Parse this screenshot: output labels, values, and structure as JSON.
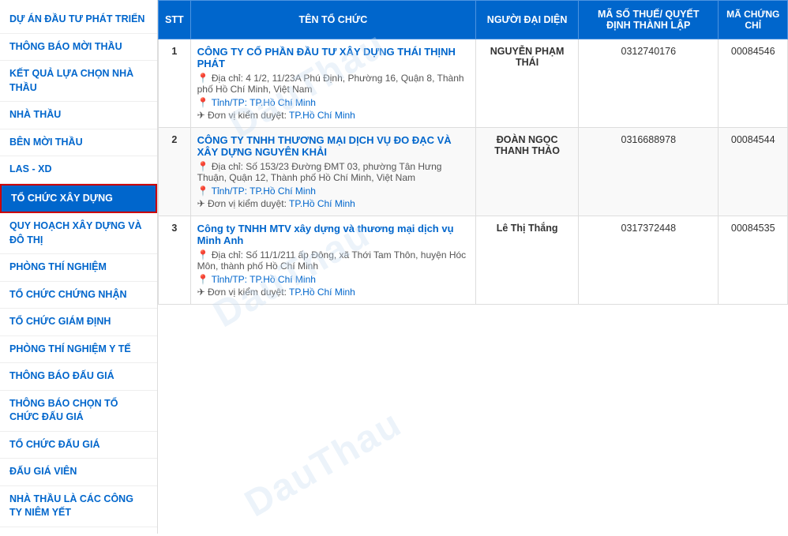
{
  "sidebar": {
    "items": [
      {
        "id": "duan",
        "label": "DỰ ÁN ĐẦU TƯ PHÁT TRIỂN",
        "active": false
      },
      {
        "id": "thongbaomoi",
        "label": "THÔNG BÁO MỜI THẦU",
        "active": false
      },
      {
        "id": "ketqua",
        "label": "KẾT QUẢ LỰA CHỌN NHÀ THẦU",
        "active": false
      },
      {
        "id": "nhathau",
        "label": "NHÀ THẦU",
        "active": false
      },
      {
        "id": "benmoithau",
        "label": "BÊN MỜI THẦU",
        "active": false
      },
      {
        "id": "lasxd",
        "label": "LAS - XD",
        "active": false
      },
      {
        "id": "tochucxaydung",
        "label": "TỔ CHỨC XÂY DỰNG",
        "active": true
      },
      {
        "id": "quyhoach",
        "label": "QUY HOẠCH XÂY DỰNG VÀ ĐÔ THỊ",
        "active": false
      },
      {
        "id": "phongthi",
        "label": "PHÒNG THÍ NGHIỆM",
        "active": false
      },
      {
        "id": "tochuchangnhan",
        "label": "TỔ CHỨC CHỨNG NHẬN",
        "active": false
      },
      {
        "id": "tochuchangiamdinh",
        "label": "TỔ CHỨC GIÁM ĐỊNH",
        "active": false
      },
      {
        "id": "phongthinghiemyte",
        "label": "PHÒNG THÍ NGHIỆM Y TẾ",
        "active": false
      },
      {
        "id": "thongbaodaugia",
        "label": "THÔNG BÁO ĐẤU GIÁ",
        "active": false
      },
      {
        "id": "thongbaochon",
        "label": "THÔNG BÁO CHỌN TỔ CHỨC ĐẤU GIÁ",
        "active": false
      },
      {
        "id": "tochucĐaugia",
        "label": "TỔ CHỨC ĐẤU GIÁ",
        "active": false
      },
      {
        "id": "daugiaviên",
        "label": "ĐẤU GIÁ VIÊN",
        "active": false
      },
      {
        "id": "nhathaulacac",
        "label": "NHÀ THẦU LÀ CÁC CÔNG TY NIÊM YẾT",
        "active": false
      }
    ]
  },
  "table": {
    "headers": {
      "stt": "STT",
      "tenToChuc": "TÊN TỔ CHỨC",
      "nguoiDaiDien": "NGƯỜI ĐẠI DIỆN",
      "maSoThue": "MÃ SỐ THUẾ/ QUYẾT ĐỊNH THÀNH LẬP",
      "maChungChi": "MÃ CHỨNG CHỈ"
    },
    "rows": [
      {
        "stt": "1",
        "orgName": "CÔNG TY CỔ PHẦN ĐẦU TƯ XÂY DỰNG THÁI THỊNH PHÁT",
        "address": "Địa chỉ: 4 1/2, 11/23A Phú Định, Phường 16, Quận 8, Thành phố Hồ Chí Minh, Việt Nam",
        "city": "Tỉnh/TP: TP.Hồ Chí Minh",
        "approveUnit": "Đơn vị kiểm duyệt: TP.Hồ Chí Minh",
        "rep": "NGUYỄN PHẠM THÁI",
        "taxCode": "0312740176",
        "certCode": "00084546"
      },
      {
        "stt": "2",
        "orgName": "CÔNG TY TNHH THƯƠNG MẠI DỊCH VỤ ĐO ĐẠC VÀ XÂY DỰNG NGUYÊN KHẢI",
        "address": "Địa chỉ: Số 153/23 Đường ĐMT 03, phường Tân Hưng Thuận, Quận 12, Thành phố Hồ Chí Minh, Việt Nam",
        "city": "Tỉnh/TP: TP.Hồ Chí Minh",
        "approveUnit": "Đơn vị kiểm duyệt: TP.Hồ Chí Minh",
        "rep": "ĐOÀN NGỌC THANH THẢO",
        "taxCode": "0316688978",
        "certCode": "00084544"
      },
      {
        "stt": "3",
        "orgName": "Công ty TNHH MTV xây dựng và thương mại dịch vụ Minh Anh",
        "address": "Địa chỉ: Số 11/1/211 ấp Đông, xã Thới Tam Thôn, huyện Hóc Môn, thành phố Hồ Chí Minh",
        "city": "Tỉnh/TP: TP.Hồ Chí Minh",
        "approveUnit": "Đơn vị kiểm duyệt: TP.Hồ Chí Minh",
        "rep": "Lê Thị Thắng",
        "taxCode": "0317372448",
        "certCode": "00084535"
      }
    ]
  },
  "watermark": {
    "text1": "DauThau",
    "text2": "DauThau",
    "text3": "DauThau"
  },
  "certBadge": "MA\nCHUNG CHỉ"
}
